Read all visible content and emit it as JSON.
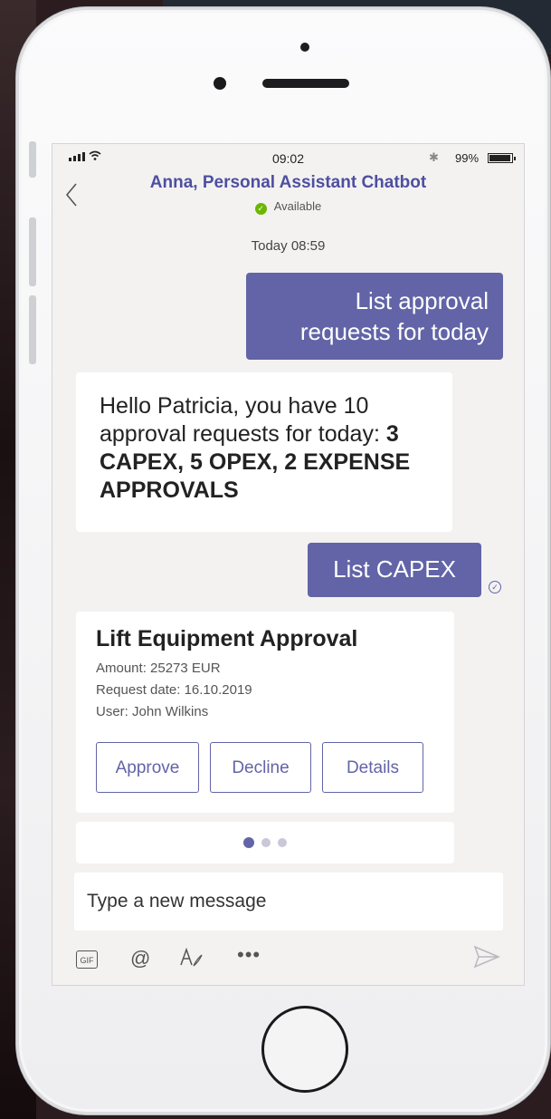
{
  "status_bar": {
    "time": "09:02",
    "battery": "99%"
  },
  "header": {
    "title": "Anna, Personal Assistant Chatbot",
    "presence": "Available"
  },
  "chat": {
    "date_separator": "Today 08:59",
    "messages": [
      {
        "from": "user",
        "text": "List approval requests for today"
      },
      {
        "from": "bot",
        "text": "Hello Patricia, you have 10 approval requests for today:",
        "bold": "3 CAPEX, 5 OPEX, 2 EXPENSE APPROVALS"
      },
      {
        "from": "user",
        "text": "List CAPEX"
      }
    ],
    "card": {
      "title": "Lift Equipment Approval",
      "amount": "Amount: 25273 EUR",
      "request_date": "Request date: 16.10.2019",
      "user": "User: John Wilkins",
      "actions": [
        "Approve",
        "Decline",
        "Details"
      ],
      "carousel": {
        "pages": 3,
        "active": 1
      }
    }
  },
  "composer": {
    "placeholder": "Type a new message",
    "tools": [
      "gif-icon",
      "mention-icon",
      "format-icon",
      "more-icon",
      "send-icon"
    ]
  },
  "colors": {
    "accent": "#6264a7",
    "available": "#6bb700",
    "title": "#4e4fa0"
  }
}
